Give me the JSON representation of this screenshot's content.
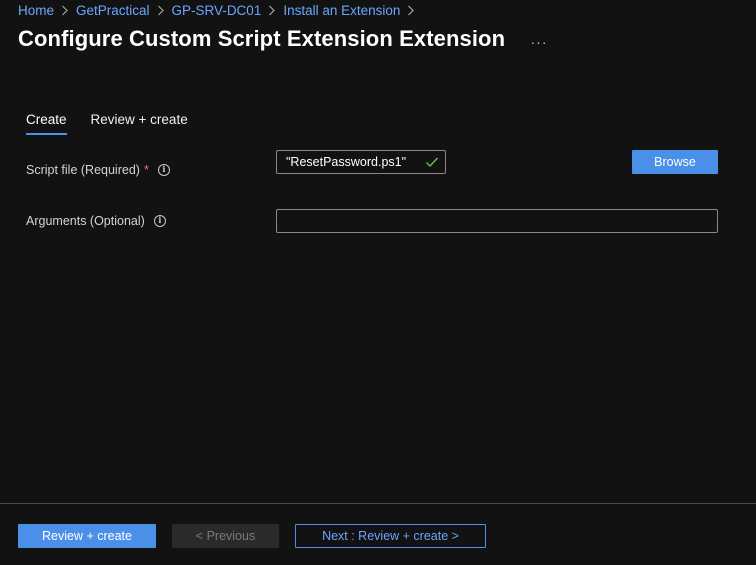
{
  "breadcrumb": {
    "items": [
      {
        "label": "Home"
      },
      {
        "label": "GetPractical"
      },
      {
        "label": "GP-SRV-DC01"
      },
      {
        "label": "Install an Extension"
      }
    ]
  },
  "page": {
    "title": "Configure Custom Script Extension Extension",
    "more_label": "···"
  },
  "tabs": [
    {
      "label": "Create",
      "active": true
    },
    {
      "label": "Review + create",
      "active": false
    }
  ],
  "form": {
    "script_file": {
      "label": "Script file (Required)",
      "required_marker": "*",
      "value": "\"ResetPassword.ps1\"",
      "browse_label": "Browse"
    },
    "arguments": {
      "label": "Arguments (Optional)",
      "value": ""
    },
    "info_glyph": "i"
  },
  "footer": {
    "review_create_label": "Review + create",
    "previous_label": "< Previous",
    "next_label": "Next : Review + create >"
  },
  "colors": {
    "accent": "#4a8fe8",
    "link": "#6aa6ff",
    "background": "#121212",
    "success": "#6cc04a",
    "required": "#ff6b6b"
  }
}
